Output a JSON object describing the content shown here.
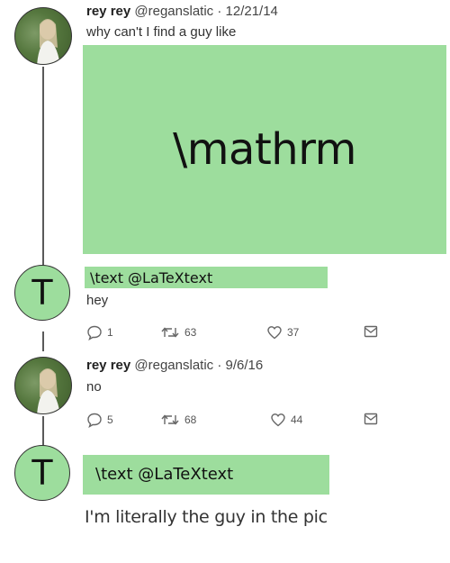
{
  "tweet1": {
    "display_name": "rey rey",
    "handle": "@reganslatic",
    "separator": "·",
    "date": "12/21/14",
    "text": "why can't I find a guy like",
    "overlay_text": "\\mathrm"
  },
  "tweet2": {
    "avatar_letter": "T",
    "overlay_label": "\\text @LaTeXtext",
    "text": "hey",
    "replies": "1",
    "retweets": "63",
    "likes": "37"
  },
  "tweet3": {
    "display_name": "rey rey",
    "handle": "@reganslatic",
    "separator": "·",
    "date": "9/6/16",
    "text": "no",
    "replies": "5",
    "retweets": "68",
    "likes": "44"
  },
  "tweet4": {
    "avatar_letter": "T",
    "overlay_label": "\\text @LaTeXtext",
    "text": "I'm literally the guy in the pic"
  },
  "colors": {
    "overlay_green": "#9ddd9d"
  }
}
